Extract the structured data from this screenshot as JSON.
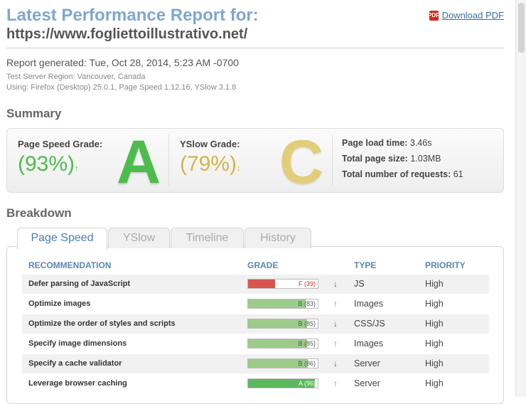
{
  "header": {
    "title": "Latest Performance Report for:",
    "url": "https://www.fogliettoillustrativo.net/",
    "download_label": "Download PDF",
    "pdf_icon_text": "PDF"
  },
  "report": {
    "generated": "Report generated: Tue, Oct 28, 2014, 5:23 AM -0700",
    "region": "Test Server Region: Vancouver, Canada",
    "using": "Using: Firefox (Desktop) 25.0.1, Page Speed 1.12.16, YSlow 3.1.8"
  },
  "summary": {
    "title": "Summary",
    "pagespeed": {
      "label": "Page Speed Grade:",
      "pct": "(93%)",
      "arrow": "↑",
      "grade": "A",
      "color": "#4cbd4c"
    },
    "yslow": {
      "label": "YSlow Grade:",
      "pct": "(79%)",
      "arrow": "↕",
      "grade": "C",
      "color": "#d4b44a"
    },
    "stats": [
      {
        "label": "Page load time:",
        "value": "3.46s"
      },
      {
        "label": "Total page size:",
        "value": "1.03MB"
      },
      {
        "label": "Total number of requests:",
        "value": "61"
      }
    ]
  },
  "breakdown": {
    "title": "Breakdown",
    "tabs": [
      "Page Speed",
      "YSlow",
      "Timeline",
      "History"
    ],
    "active_tab": "Page Speed",
    "columns": [
      "RECOMMENDATION",
      "GRADE",
      "TYPE",
      "PRIORITY"
    ],
    "rows": [
      {
        "rec": "Defer parsing of JavaScript",
        "grade": "F (39)",
        "fill": 39,
        "color": "#d9534f",
        "label_color": "#c9302c",
        "trend": "↓",
        "trend_color": "#c9302c",
        "type": "JS",
        "priority": "High"
      },
      {
        "rec": "Optimize images",
        "grade": "B (83)",
        "fill": 83,
        "color": "#9ccb8a",
        "label_color": "#555555",
        "trend": "↑",
        "trend_color": "#5aa05a",
        "type": "Images",
        "priority": "High"
      },
      {
        "rec": "Optimize the order of styles and scripts",
        "grade": "B (85)",
        "fill": 85,
        "color": "#9ccb8a",
        "label_color": "#555555",
        "trend": "↓",
        "trend_color": "#c9302c",
        "type": "CSS/JS",
        "priority": "High"
      },
      {
        "rec": "Specify image dimensions",
        "grade": "B (85)",
        "fill": 85,
        "color": "#9ccb8a",
        "label_color": "#555555",
        "trend": "↑",
        "trend_color": "#5aa05a",
        "type": "Images",
        "priority": "High"
      },
      {
        "rec": "Specify a cache validator",
        "grade": "B (86)",
        "fill": 86,
        "color": "#9ccb8a",
        "label_color": "#555555",
        "trend": "↓",
        "trend_color": "#c9302c",
        "type": "Server",
        "priority": "High"
      },
      {
        "rec": "Leverage browser caching",
        "grade": "A (96)",
        "fill": 96,
        "color": "#5cb85c",
        "label_color": "#ffffff",
        "trend": "↑",
        "trend_color": "#5aa05a",
        "type": "Server",
        "priority": "High"
      }
    ]
  }
}
